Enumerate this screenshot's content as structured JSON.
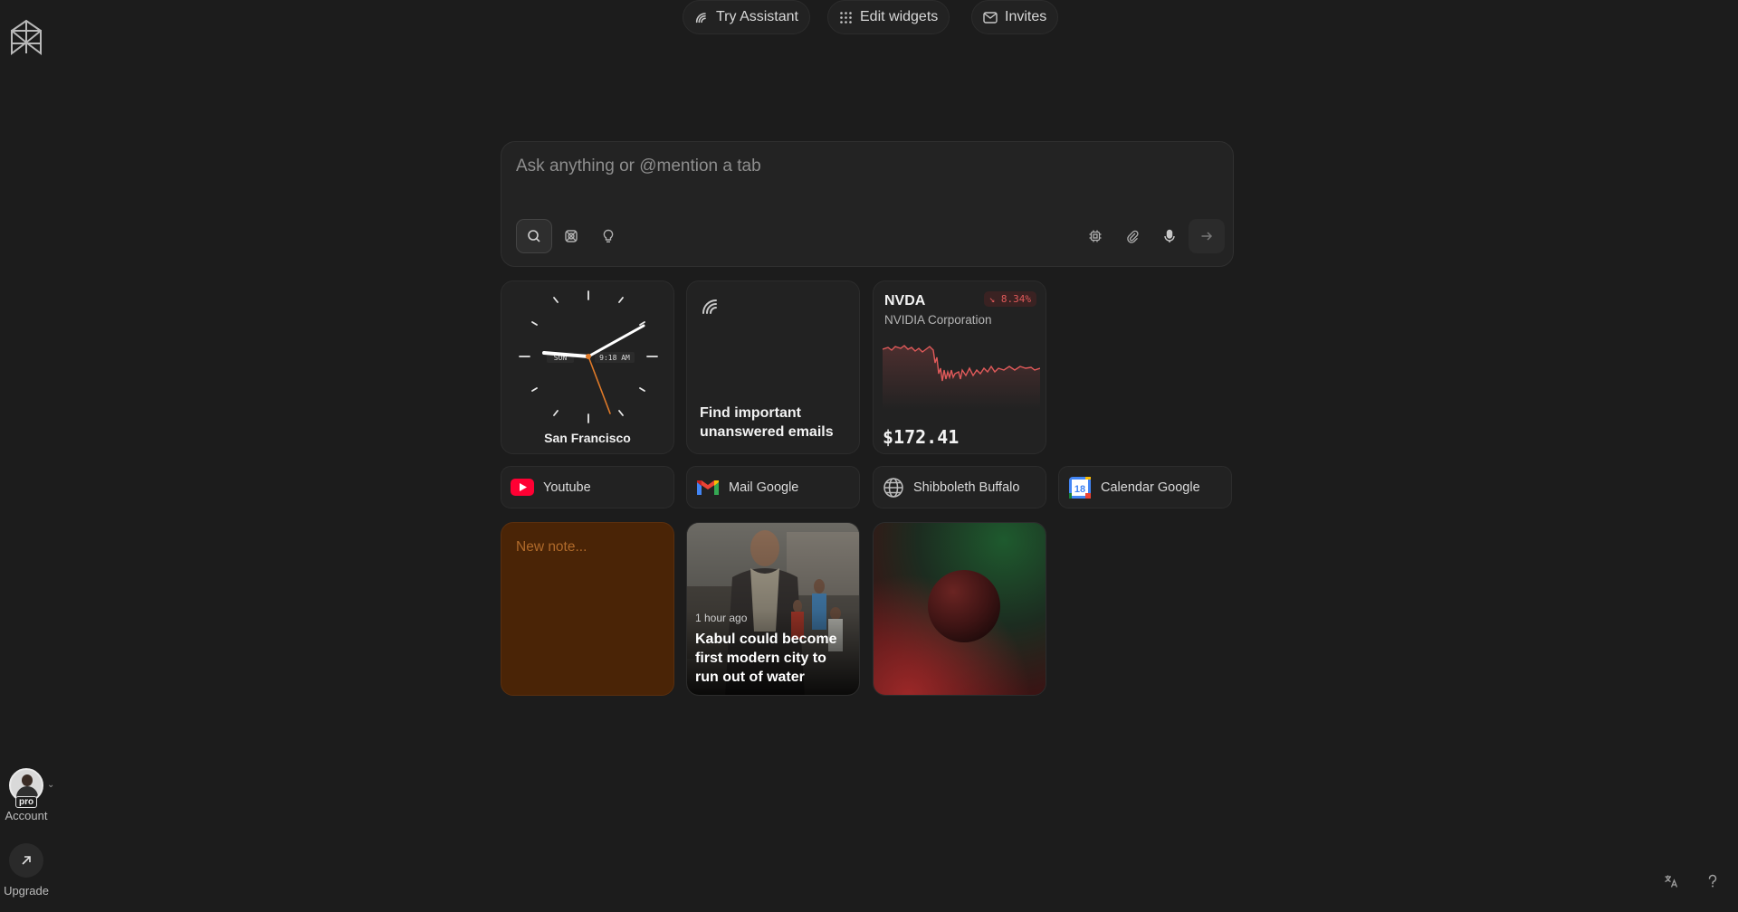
{
  "sidebar": {
    "account_label": "Account",
    "pro_badge": "pro",
    "upgrade_label": "Upgrade"
  },
  "search": {
    "placeholder": "Ask anything or @mention a tab"
  },
  "widgets": {
    "clock": {
      "city": "San Francisco",
      "day": "SUN",
      "time": "9:18 AM"
    },
    "assistant": {
      "prompt": "Find important unanswered emails"
    },
    "stock": {
      "ticker": "NVDA",
      "name": "NVIDIA Corporation",
      "change": "↘ 8.34%",
      "price": "$172.41",
      "trend_color": "#e05a5a"
    }
  },
  "shortcuts": [
    {
      "label": "Youtube",
      "icon": "youtube-icon"
    },
    {
      "label": "Mail Google",
      "icon": "gmail-icon"
    },
    {
      "label": "Shibboleth Buffalo",
      "icon": "globe-icon"
    },
    {
      "label": "Calendar Google",
      "icon": "google-calendar-icon",
      "badge": "18"
    }
  ],
  "note": {
    "placeholder": "New note..."
  },
  "news": {
    "time": "1 hour ago",
    "title": "Kabul could become first modern city to run out of water"
  },
  "bottom": {
    "try_assistant": "Try Assistant",
    "edit_widgets": "Edit widgets",
    "invites": "Invites"
  },
  "colors": {
    "background": "#1c1c1c",
    "note_bg": "#4a2406",
    "clock_second_hand": "#e07a28"
  }
}
